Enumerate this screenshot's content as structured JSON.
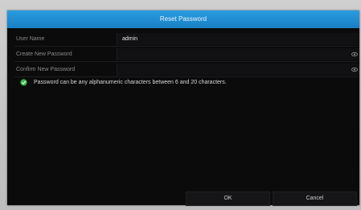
{
  "dialog": {
    "title": "Reset Password"
  },
  "form": {
    "rows": [
      {
        "label": "User Name",
        "value": "admin"
      },
      {
        "label": "Create New Password",
        "value": ""
      },
      {
        "label": "Confirm New Password",
        "value": ""
      }
    ]
  },
  "hint": {
    "icon": "check-circle-icon",
    "text": "Password can be any alphanumeric characters between 6 and 20 characters."
  },
  "buttons": {
    "ok_label": "OK",
    "cancel_label": "Cancel"
  },
  "colors": {
    "title_bar": "#1e8ad0",
    "dialog_bg": "#0b0b0c",
    "hint_icon": "#3bb54a"
  }
}
